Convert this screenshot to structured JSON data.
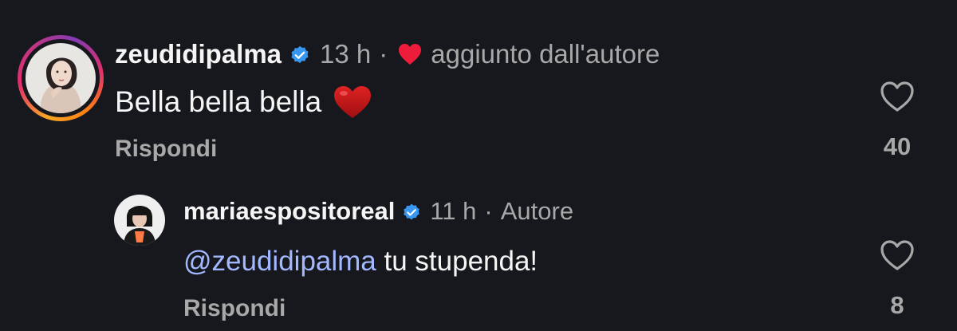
{
  "comments": [
    {
      "username": "zeudidipalma",
      "time": "13 h",
      "separator": "·",
      "badge_text": "aggiunto dall'autore",
      "text": "Bella bella bella",
      "emoji": "♥",
      "reply_label": "Rispondi",
      "likes": "40"
    },
    {
      "username": "mariaespositoreal",
      "time": "11 h",
      "separator": "·",
      "badge_text": "Autore",
      "mention": "@zeudidipalma",
      "text": " tu stupenda!",
      "reply_label": "Rispondi",
      "likes": "8"
    }
  ],
  "colors": {
    "background": "#16181d",
    "text": "#f5f5f5",
    "muted": "#a8a8a8",
    "mention": "#a3b8ff",
    "verified": "#3897f0",
    "heart": "#ed1c3a"
  },
  "icons": {
    "verified": "verified-badge-icon",
    "liked_by_author": "red-heart-icon",
    "like": "heart-outline-icon"
  }
}
